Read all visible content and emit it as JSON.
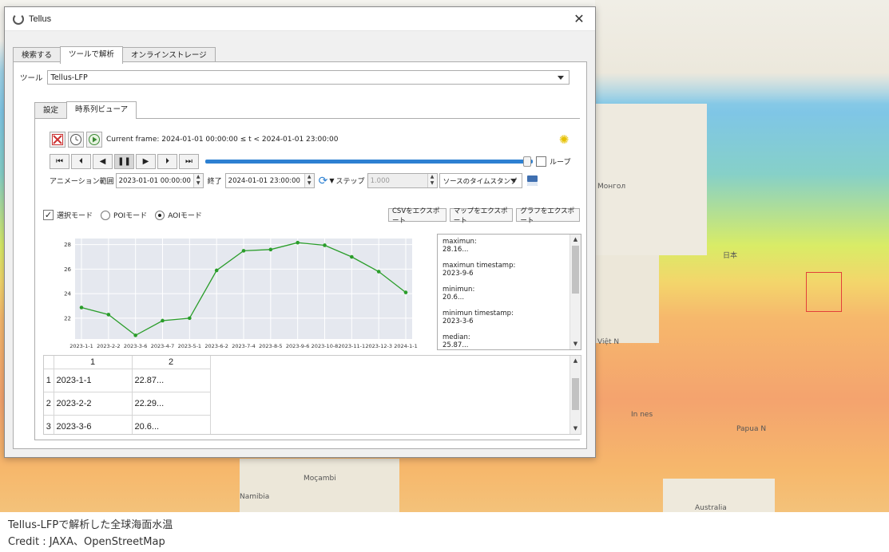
{
  "window": {
    "title": "Tellus",
    "close_glyph": "✕"
  },
  "outer_tabs": [
    {
      "label": "検索する"
    },
    {
      "label": "ツールで解析",
      "active": true
    },
    {
      "label": "オンラインストレージ"
    }
  ],
  "tool": {
    "label": "ツール",
    "value": "Tellus-LFP"
  },
  "inner_tabs": [
    {
      "label": "設定"
    },
    {
      "label": "時系列ビューア",
      "active": true
    }
  ],
  "playback": {
    "current_frame": "Current frame: 2024-01-01 00:00:00 ≤ t < 2024-01-01 23:00:00",
    "loop_label": "ループ",
    "loop_checked": false
  },
  "animation": {
    "range_label": "アニメーション範囲",
    "start": "2023-01-01 00:00:00",
    "end_label": "終了",
    "end": "2024-01-01 23:00:00",
    "step_label": "ステップ",
    "step_value": "1.000",
    "timestamp_source": "ソースのタイムスタンプ"
  },
  "modes": {
    "select_label": "選択モード",
    "select_checked": true,
    "poi_label": "POIモード",
    "aoi_label": "AOIモード",
    "selected": "aoi"
  },
  "export": {
    "csv": "CSVをエクスポート",
    "map": "マップをエクスポート",
    "graph": "グラフをエクスポート"
  },
  "stats": [
    {
      "label": "maximun:",
      "value": "28.16..."
    },
    {
      "label": "maximun timestamp:",
      "value": "2023-9-6"
    },
    {
      "label": "minimun:",
      "value": "20.6..."
    },
    {
      "label": "minimun timestamp:",
      "value": "2023-3-6"
    },
    {
      "label": "median:",
      "value": "25.87..."
    }
  ],
  "table": {
    "headers": [
      "1",
      "2"
    ],
    "rows": [
      {
        "n": "1",
        "date": "2023-1-1",
        "value": "22.87..."
      },
      {
        "n": "2",
        "date": "2023-2-2",
        "value": "22.29..."
      },
      {
        "n": "3",
        "date": "2023-3-6",
        "value": "20.6..."
      }
    ]
  },
  "map_labels": {
    "mongol": "Монгол",
    "nihon": "日本",
    "vietnam": "Việt N",
    "indonesia": "In     nes",
    "papua": "Papua N",
    "mocambique": "Moçambi",
    "namibia": "Namibia",
    "australia": "Australia"
  },
  "caption": {
    "line1": "Tellus-LFPで解析した全球海面水温",
    "line2": "Credit : JAXA、OpenStreetMap"
  },
  "colors": {
    "series": "#2a9d2a",
    "slider": "#2d80d2",
    "roi": "#e2403a"
  },
  "chart_data": {
    "type": "line",
    "categories": [
      "2023-1-1",
      "2023-2-2",
      "2023-3-6",
      "2023-4-7",
      "2023-5-1",
      "2023-6-2",
      "2023-7-4",
      "2023-8-5",
      "2023-9-6",
      "2023-10-8",
      "2023-11-1",
      "2023-12-3",
      "2024-1-1"
    ],
    "series": [
      {
        "values": [
          22.87,
          22.29,
          20.6,
          21.8,
          22.0,
          25.9,
          27.5,
          27.6,
          28.16,
          27.95,
          27.0,
          25.8,
          24.1
        ]
      }
    ],
    "yticks": [
      22,
      24,
      26,
      28
    ],
    "ylim": [
      20.3,
      28.5
    ],
    "grid": true
  }
}
